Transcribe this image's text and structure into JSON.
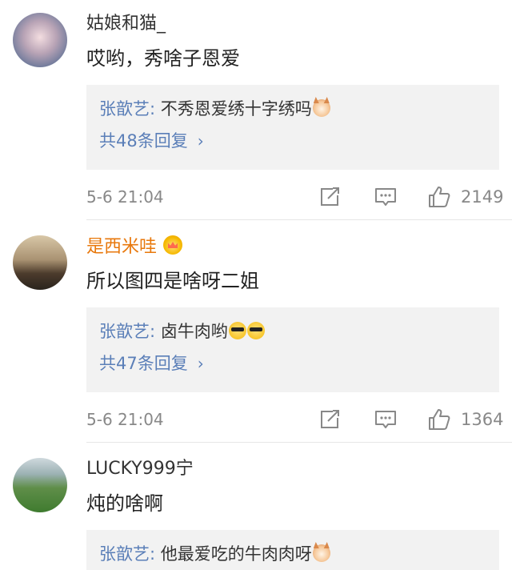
{
  "comments": [
    {
      "username": "姑娘和猫_",
      "text": "哎哟，秀啥子恩爱",
      "reply": {
        "author": "张歆艺:",
        "text": "不秀恩爱绣十字绣吗"
      },
      "reply_count": "共48条回复",
      "timestamp": "5-6 21:04",
      "likes": "2149"
    },
    {
      "username": "是西米哇",
      "text": "所以图四是啥呀二姐",
      "reply": {
        "author": "张歆艺:",
        "text": "卤牛肉哟"
      },
      "reply_count": "共47条回复",
      "timestamp": "5-6 21:04",
      "likes": "1364"
    },
    {
      "username": "LUCKY999宁",
      "text": "炖的啥啊",
      "reply": {
        "author": "张歆艺:",
        "text": "他最爱吃的牛肉肉呀"
      }
    }
  ],
  "icons": {
    "share": "share-icon",
    "comment": "comment-icon",
    "like": "thumbs-up-icon",
    "cat_emoji": "cat-emoji-icon",
    "cool_emoji": "sunglasses-emoji-icon",
    "crown": "crown-badge-icon"
  },
  "colors": {
    "link": "#5b7fb8",
    "vip_name": "#e8780c",
    "meta": "#888888",
    "reply_bg": "#f2f2f2"
  }
}
